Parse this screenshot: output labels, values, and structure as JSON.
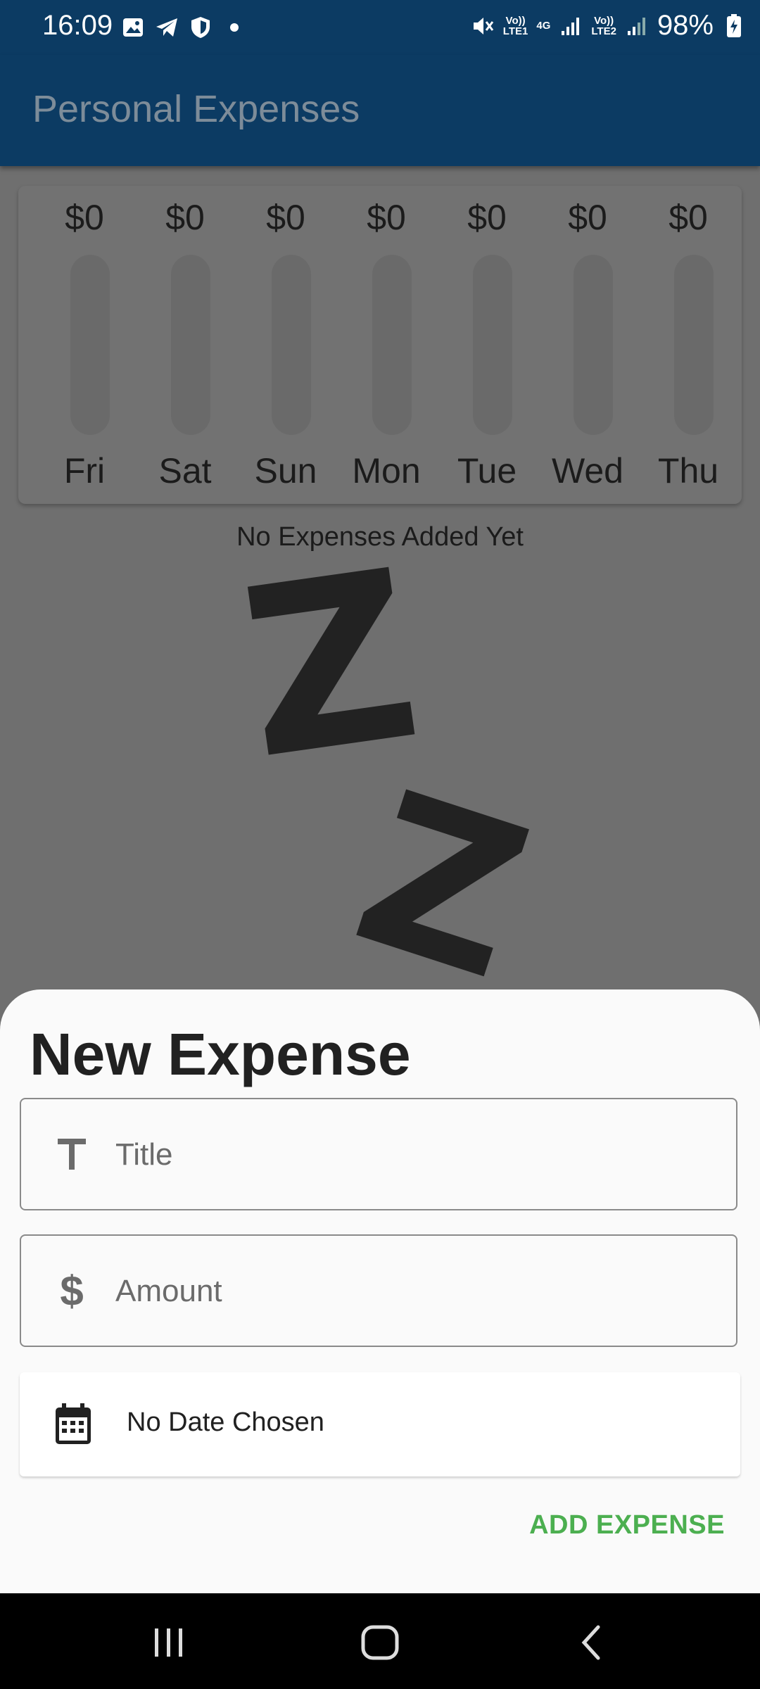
{
  "status_bar": {
    "time": "16:09",
    "left_icons": [
      "image-icon",
      "telegram-icon",
      "shield-icon",
      "dot-icon"
    ],
    "lte1_label": "Vo))\nLTE1",
    "lte2_label": "Vo))\nLTE2",
    "network_label": "4G",
    "battery": "98%"
  },
  "app_bar": {
    "title": "Personal Expenses"
  },
  "chart": {
    "bars": [
      {
        "day": "Fri",
        "amount": "$0",
        "fill": 0
      },
      {
        "day": "Sat",
        "amount": "$0",
        "fill": 0
      },
      {
        "day": "Sun",
        "amount": "$0",
        "fill": 0
      },
      {
        "day": "Mon",
        "amount": "$0",
        "fill": 0
      },
      {
        "day": "Tue",
        "amount": "$0",
        "fill": 0
      },
      {
        "day": "Wed",
        "amount": "$0",
        "fill": 0
      },
      {
        "day": "Thu",
        "amount": "$0",
        "fill": 0
      }
    ]
  },
  "empty_state": {
    "text": "No Expenses Added Yet",
    "z1": "Z",
    "z2": "Z"
  },
  "sheet": {
    "title": "New Expense",
    "title_field": {
      "placeholder": "Title",
      "value": ""
    },
    "amount_field": {
      "placeholder": "Amount",
      "value": ""
    },
    "date_text": "No Date Chosen",
    "add_button": "ADD EXPENSE"
  },
  "colors": {
    "accent": "#4caf50",
    "app_bar": "#0c3b63",
    "scrim": "#6f6f6f"
  }
}
